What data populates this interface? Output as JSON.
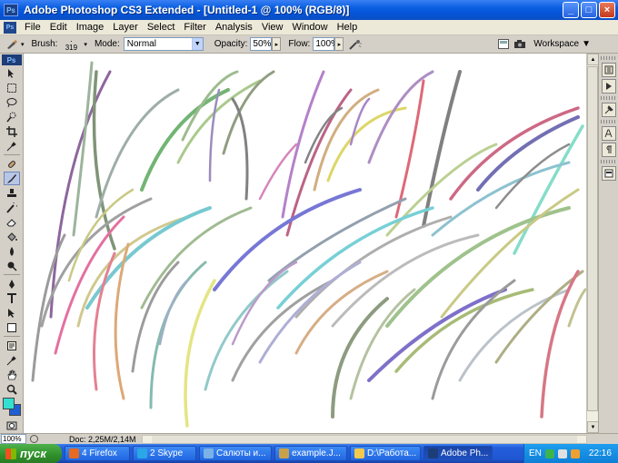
{
  "window": {
    "title": "Adobe Photoshop CS3 Extended - [Untitled-1 @ 100% (RGB/8)]",
    "app_icon": "Ps",
    "buttons": {
      "minimize": "_",
      "maximize": "□",
      "close": "×"
    }
  },
  "menubar": {
    "items": [
      "File",
      "Edit",
      "Image",
      "Layer",
      "Select",
      "Filter",
      "Analysis",
      "View",
      "Window",
      "Help"
    ]
  },
  "options": {
    "brush_label": "Brush:",
    "brush_size": "319",
    "mode_label": "Mode:",
    "mode_value": "Normal",
    "opacity_label": "Opacity:",
    "opacity_value": "50%",
    "flow_label": "Flow:",
    "flow_value": "100%",
    "workspace_label": "Workspace"
  },
  "toolbox": {
    "logo": "Ps",
    "tools": [
      "move-tool-icon",
      "marquee-tool-icon",
      "lasso-tool-icon",
      "quick-select-tool-icon",
      "crop-tool-icon",
      "eyedropper-tool-icon",
      "healing-brush-tool-icon",
      "brush-tool-icon",
      "clone-stamp-tool-icon",
      "history-brush-tool-icon",
      "eraser-tool-icon",
      "paint-bucket-tool-icon",
      "blur-tool-icon",
      "dodge-tool-icon",
      "pen-tool-icon",
      "type-tool-icon",
      "path-select-tool-icon",
      "shape-tool-icon",
      "notes-tool-icon",
      "eyedropper2-tool-icon",
      "hand-tool-icon",
      "zoom-tool-icon"
    ],
    "active_tool": "brush-tool-icon",
    "foreground_color": "#33e0d0",
    "background_color": "#1e5fd4"
  },
  "canvas": {
    "background": "#ffffff"
  },
  "statusbar": {
    "zoom": "100%",
    "doc": "Doc: 2,25M/2,14M"
  },
  "taskbar": {
    "start_label": "пуск",
    "tasks": [
      {
        "label": "4 Firefox",
        "color": "#e66a1f"
      },
      {
        "label": "2 Skype",
        "color": "#2aa7e6"
      },
      {
        "label": "Салюты и...",
        "color": "#7ab2e8"
      },
      {
        "label": "example.J...",
        "color": "#c9a14a"
      },
      {
        "label": "D:\\Работа...",
        "color": "#f2c94c"
      },
      {
        "label": "Adobe Ph...",
        "color": "#1d3d78"
      }
    ],
    "tray": {
      "lang": "EN",
      "time": "22:16"
    }
  }
}
